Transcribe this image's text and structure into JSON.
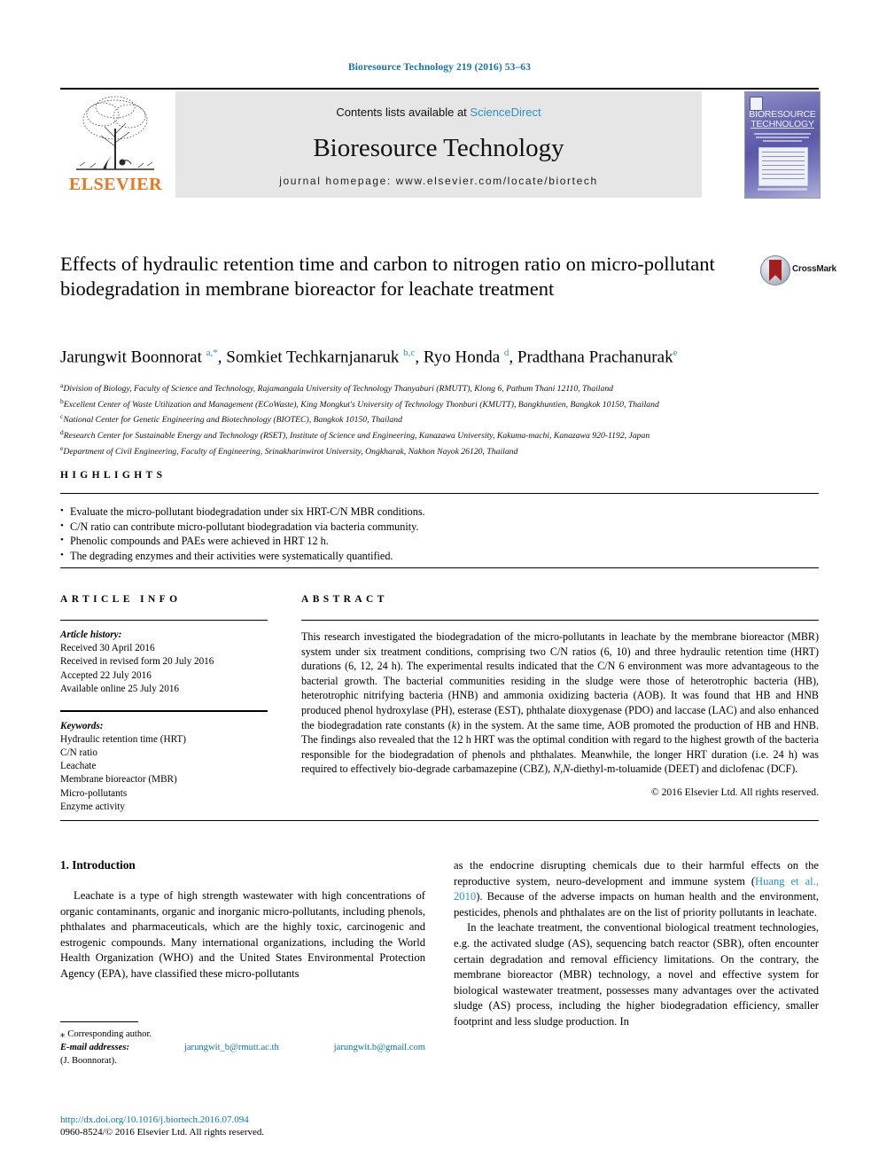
{
  "running_head": "Bioresource Technology 219 (2016) 53–63",
  "masthead": {
    "contents_prefix": "Contents lists available at ",
    "sciencedirect": "ScienceDirect",
    "journal_name": "Bioresource Technology",
    "homepage": "journal homepage: www.elsevier.com/locate/biortech",
    "publisher": "ELSEVIER",
    "cover_title_line1": "BIORESOURCE",
    "cover_title_line2": "TECHNOLOGY"
  },
  "article": {
    "title": "Effects of hydraulic retention time and carbon to nitrogen ratio on micro-pollutant biodegradation in membrane bioreactor for leachate treatment",
    "crossmark_label": "CrossMark",
    "authors_html": "Jarungwit Boonnorat <sup>a,*</sup>, Somkiet Techkarnjanaruk <sup>b,c</sup>, Ryo Honda <sup>d</sup>, Pradthana Prachanurak<sup>e</sup>",
    "affiliations": [
      {
        "mark": "a",
        "text": "Division of Biology, Faculty of Science and Technology, Rajamangala University of Technology Thanyaburi (RMUTT), Klong 6, Pathum Thani 12110, Thailand"
      },
      {
        "mark": "b",
        "text": "Excellent Center of Waste Utilization and Management (ECoWaste), King Mongkut's University of Technology Thonburi (KMUTT), Bangkhuntien, Bangkok 10150, Thailand"
      },
      {
        "mark": "c",
        "text": "National Center for Genetic Engineering and Biotechnology (BIOTEC), Bangkok 10150, Thailand"
      },
      {
        "mark": "d",
        "text": "Research Center for Sustainable Energy and Technology (RSET), Institute of Science and Engineering, Kanazawa University, Kakuma-machi, Kanazawa 920-1192, Japan"
      },
      {
        "mark": "e",
        "text": "Department of Civil Engineering, Faculty of Engineering, Srinakharinwirot University, Ongkharak, Nakhon Nayok 26120, Thailand"
      }
    ]
  },
  "highlights": {
    "label": "HIGHLIGHTS",
    "items": [
      "Evaluate the micro-pollutant biodegradation under six HRT-C/N MBR conditions.",
      "C/N ratio can contribute micro-pollutant biodegradation via bacteria community.",
      "Phenolic compounds and PAEs were achieved in HRT 12 h.",
      "The degrading enzymes and their activities were systematically quantified."
    ]
  },
  "article_info": {
    "label": "ARTICLE INFO",
    "history_label": "Article history:",
    "history": [
      "Received 30 April 2016",
      "Received in revised form 20 July 2016",
      "Accepted 22 July 2016",
      "Available online 25 July 2016"
    ],
    "keywords_label": "Keywords:",
    "keywords": [
      "Hydraulic retention time (HRT)",
      "C/N ratio",
      "Leachate",
      "Membrane bioreactor (MBR)",
      "Micro-pollutants",
      "Enzyme activity"
    ]
  },
  "abstract": {
    "label": "ABSTRACT",
    "text_part1": "This research investigated the biodegradation of the micro-pollutants in leachate by the membrane bioreactor (MBR) system under six treatment conditions, comprising two C/N ratios (6, 10) and three hydraulic retention time (HRT) durations (6, 12, 24 h). The experimental results indicated that the C/N 6 environment was more advantageous to the bacterial growth. The bacterial communities residing in the sludge were those of heterotrophic bacteria (HB), heterotrophic nitrifying bacteria (HNB) and ammonia oxidizing bacteria (AOB). It was found that HB and HNB produced phenol hydroxylase (PH), esterase (EST), phthalate dioxygenase (PDO) and laccase (LAC) and also enhanced the biodegradation rate constants (",
    "k_italic": "k",
    "text_part2": ") in the system. At the same time, AOB promoted the production of HB and HNB. The findings also revealed that the 12 h HRT was the optimal condition with regard to the highest growth of the bacteria responsible for the biodegradation of phenols and phthalates. Meanwhile, the longer HRT duration (i.e. 24 h) was required to effectively bio-degrade carbamazepine (CBZ), ",
    "nn_italic": "N,N",
    "text_part3": "-diethyl-m-toluamide (DEET) and diclofenac (DCF).",
    "copyright": "© 2016 Elsevier Ltd. All rights reserved."
  },
  "introduction": {
    "heading": "1. Introduction",
    "left_para1": "Leachate is a type of high strength wastewater with high concentrations of organic contaminants, organic and inorganic micro-pollutants, including phenols, phthalates and pharmaceuticals, which are the highly toxic, carcinogenic and estrogenic compounds. Many international organizations, including the World Health Organization (WHO) and the United States Environmental Protection Agency (EPA), have classified these micro-pollutants",
    "right_para1_a": "as the endocrine disrupting chemicals due to their harmful effects on the reproductive system, neuro-development and immune system (",
    "right_citation": "Huang et al., 2010",
    "right_para1_b": "). Because of the adverse impacts on human health and the environment, pesticides, phenols and phthalates are on the list of priority pollutants in leachate.",
    "right_para2": "In the leachate treatment, the conventional biological treatment technologies, e.g. the activated sludge (AS), sequencing batch reactor (SBR), often encounter certain degradation and removal efficiency limitations. On the contrary, the membrane bioreactor (MBR) technology, a novel and effective system for biological wastewater treatment, possesses many advantages over the activated sludge (AS) process, including the higher biodegradation efficiency, smaller footprint and less sludge production. In"
  },
  "footnote": {
    "corresponding": "Corresponding author.",
    "email_label": "E-mail addresses:",
    "email1": "jarungwit_b@rmutt.ac.th",
    "email2": "jarungwit.b@gmail.com",
    "author_short": "(J. Boonnorat)."
  },
  "footer": {
    "doi": "http://dx.doi.org/10.1016/j.biortech.2016.07.094",
    "issn": "0960-8524/© 2016 Elsevier Ltd. All rights reserved."
  }
}
